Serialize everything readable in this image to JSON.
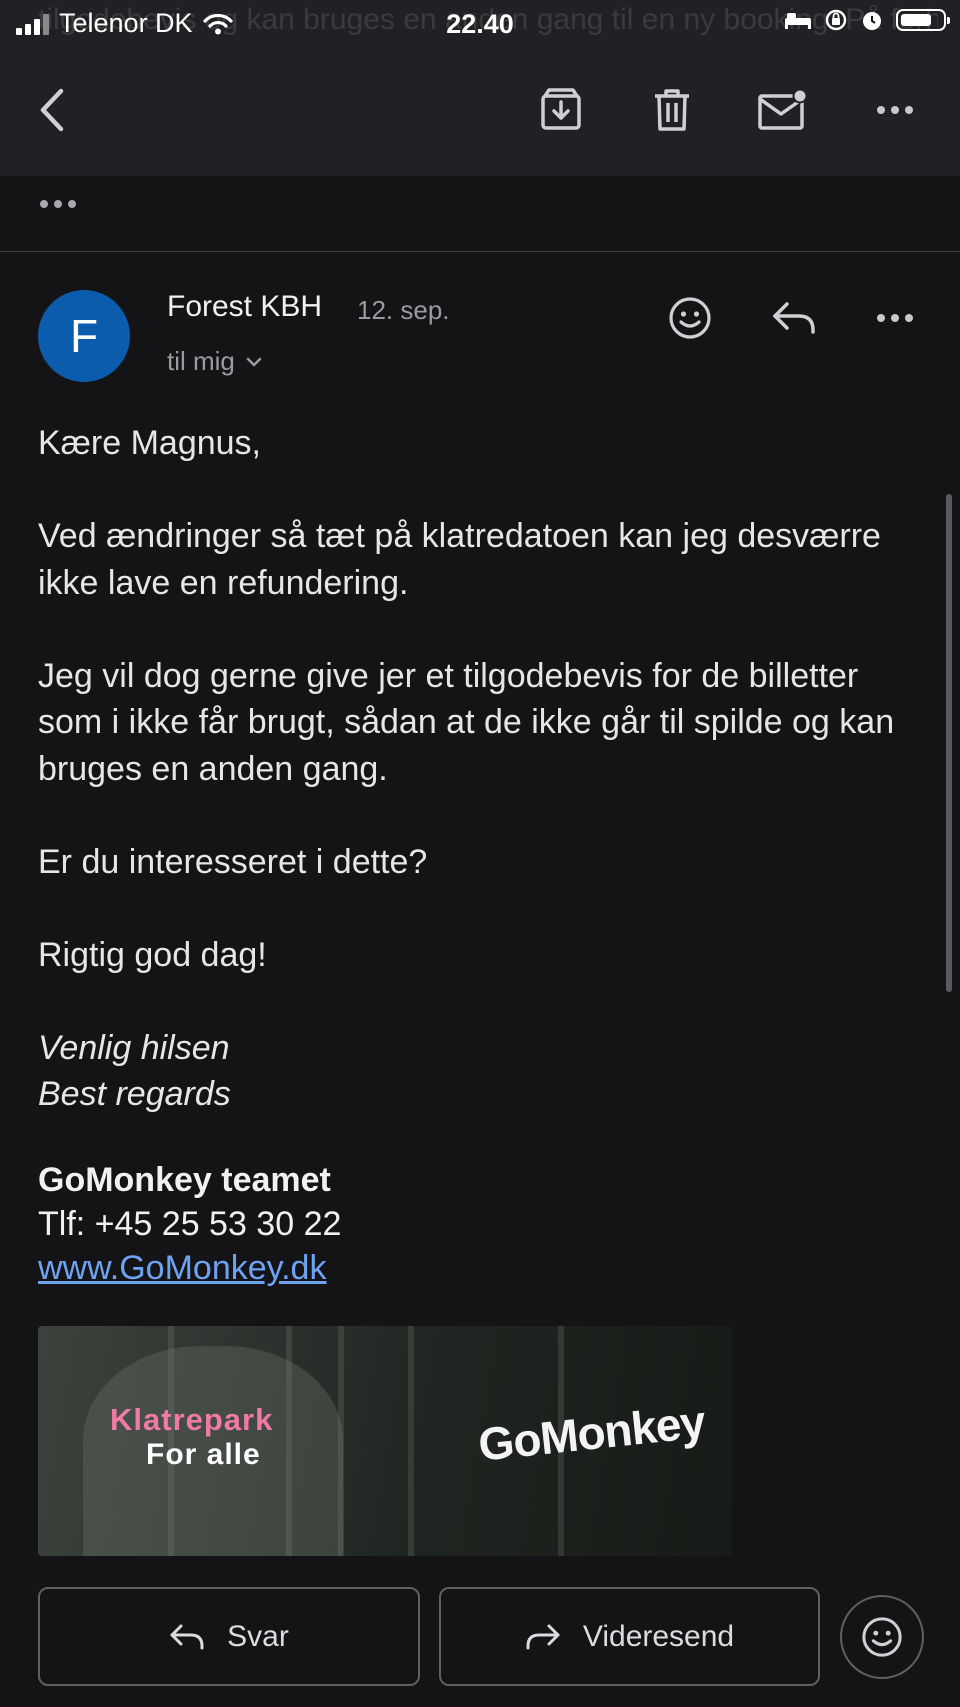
{
  "status_bar": {
    "carrier": "Telenor DK",
    "time": "22.40"
  },
  "background_preview": {
    "text": "tilgodebevis og kan bruges en anden gang til en ny booking. På forhånd tak"
  },
  "email": {
    "sender_initial": "F",
    "sender": "Forest KBH",
    "date": "12. sep.",
    "recipient": "til mig",
    "body": [
      "Kære Magnus,",
      "Ved ændringer så tæt på klatredatoen kan jeg desværre ikke lave en refundering.",
      "Jeg vil dog gerne give jer et tilgodebevis for de billetter som i ikke får brugt, sådan at de ikke går til spilde og kan bruges en anden gang.",
      "Er du interesseret i dette?",
      "Rigtig god dag!"
    ],
    "closing_1": "Venlig hilsen",
    "closing_2": "Best regards",
    "signature_team": "GoMonkey teamet",
    "signature_phone": "Tlf: +45 25 53 30 22",
    "signature_link": "www.GoMonkey.dk"
  },
  "banner": {
    "line1": "Klatrepark",
    "line2": "For alle",
    "logo": "GoMonkey"
  },
  "actions": {
    "reply_label": "Svar",
    "forward_label": "Videresend"
  },
  "icons": [
    "back-icon",
    "archive-icon",
    "trash-icon",
    "mark-unread-icon",
    "more-icon",
    "emoji-icon",
    "reply-icon",
    "forward-icon"
  ],
  "colors": {
    "avatar": "#0b5cad",
    "link": "#6ea3f2",
    "banner_pink": "#f07aa6"
  }
}
